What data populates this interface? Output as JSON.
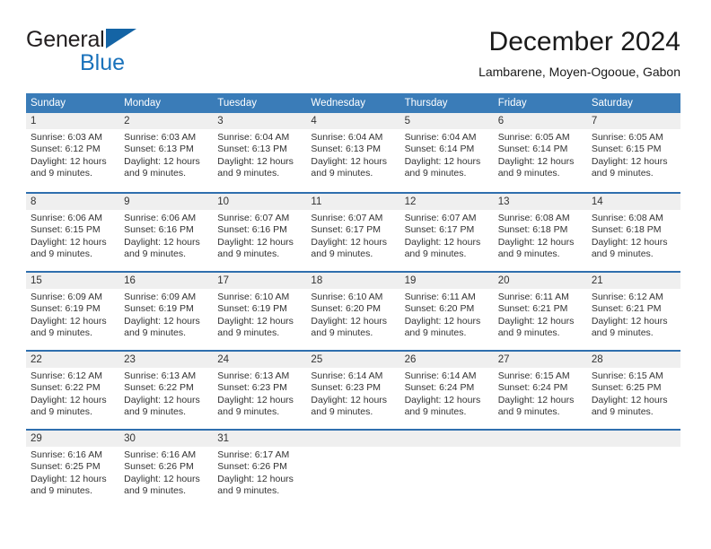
{
  "brand": {
    "word1": "General",
    "word2": "Blue",
    "triangle_color": "#1464a5",
    "word2_color": "#1a72bb"
  },
  "header": {
    "title": "December 2024",
    "subtitle": "Lambarene, Moyen-Ogooue, Gabon"
  },
  "theme": {
    "header_bg": "#3a7cb8",
    "week_divider": "#2f6fae",
    "daynum_bg": "#efefef",
    "text": "#333333"
  },
  "weekdays": [
    "Sunday",
    "Monday",
    "Tuesday",
    "Wednesday",
    "Thursday",
    "Friday",
    "Saturday"
  ],
  "weeks": [
    [
      {
        "day": "1",
        "sunrise": "Sunrise: 6:03 AM",
        "sunset": "Sunset: 6:12 PM",
        "daylight1": "Daylight: 12 hours",
        "daylight2": "and 9 minutes."
      },
      {
        "day": "2",
        "sunrise": "Sunrise: 6:03 AM",
        "sunset": "Sunset: 6:13 PM",
        "daylight1": "Daylight: 12 hours",
        "daylight2": "and 9 minutes."
      },
      {
        "day": "3",
        "sunrise": "Sunrise: 6:04 AM",
        "sunset": "Sunset: 6:13 PM",
        "daylight1": "Daylight: 12 hours",
        "daylight2": "and 9 minutes."
      },
      {
        "day": "4",
        "sunrise": "Sunrise: 6:04 AM",
        "sunset": "Sunset: 6:13 PM",
        "daylight1": "Daylight: 12 hours",
        "daylight2": "and 9 minutes."
      },
      {
        "day": "5",
        "sunrise": "Sunrise: 6:04 AM",
        "sunset": "Sunset: 6:14 PM",
        "daylight1": "Daylight: 12 hours",
        "daylight2": "and 9 minutes."
      },
      {
        "day": "6",
        "sunrise": "Sunrise: 6:05 AM",
        "sunset": "Sunset: 6:14 PM",
        "daylight1": "Daylight: 12 hours",
        "daylight2": "and 9 minutes."
      },
      {
        "day": "7",
        "sunrise": "Sunrise: 6:05 AM",
        "sunset": "Sunset: 6:15 PM",
        "daylight1": "Daylight: 12 hours",
        "daylight2": "and 9 minutes."
      }
    ],
    [
      {
        "day": "8",
        "sunrise": "Sunrise: 6:06 AM",
        "sunset": "Sunset: 6:15 PM",
        "daylight1": "Daylight: 12 hours",
        "daylight2": "and 9 minutes."
      },
      {
        "day": "9",
        "sunrise": "Sunrise: 6:06 AM",
        "sunset": "Sunset: 6:16 PM",
        "daylight1": "Daylight: 12 hours",
        "daylight2": "and 9 minutes."
      },
      {
        "day": "10",
        "sunrise": "Sunrise: 6:07 AM",
        "sunset": "Sunset: 6:16 PM",
        "daylight1": "Daylight: 12 hours",
        "daylight2": "and 9 minutes."
      },
      {
        "day": "11",
        "sunrise": "Sunrise: 6:07 AM",
        "sunset": "Sunset: 6:17 PM",
        "daylight1": "Daylight: 12 hours",
        "daylight2": "and 9 minutes."
      },
      {
        "day": "12",
        "sunrise": "Sunrise: 6:07 AM",
        "sunset": "Sunset: 6:17 PM",
        "daylight1": "Daylight: 12 hours",
        "daylight2": "and 9 minutes."
      },
      {
        "day": "13",
        "sunrise": "Sunrise: 6:08 AM",
        "sunset": "Sunset: 6:18 PM",
        "daylight1": "Daylight: 12 hours",
        "daylight2": "and 9 minutes."
      },
      {
        "day": "14",
        "sunrise": "Sunrise: 6:08 AM",
        "sunset": "Sunset: 6:18 PM",
        "daylight1": "Daylight: 12 hours",
        "daylight2": "and 9 minutes."
      }
    ],
    [
      {
        "day": "15",
        "sunrise": "Sunrise: 6:09 AM",
        "sunset": "Sunset: 6:19 PM",
        "daylight1": "Daylight: 12 hours",
        "daylight2": "and 9 minutes."
      },
      {
        "day": "16",
        "sunrise": "Sunrise: 6:09 AM",
        "sunset": "Sunset: 6:19 PM",
        "daylight1": "Daylight: 12 hours",
        "daylight2": "and 9 minutes."
      },
      {
        "day": "17",
        "sunrise": "Sunrise: 6:10 AM",
        "sunset": "Sunset: 6:19 PM",
        "daylight1": "Daylight: 12 hours",
        "daylight2": "and 9 minutes."
      },
      {
        "day": "18",
        "sunrise": "Sunrise: 6:10 AM",
        "sunset": "Sunset: 6:20 PM",
        "daylight1": "Daylight: 12 hours",
        "daylight2": "and 9 minutes."
      },
      {
        "day": "19",
        "sunrise": "Sunrise: 6:11 AM",
        "sunset": "Sunset: 6:20 PM",
        "daylight1": "Daylight: 12 hours",
        "daylight2": "and 9 minutes."
      },
      {
        "day": "20",
        "sunrise": "Sunrise: 6:11 AM",
        "sunset": "Sunset: 6:21 PM",
        "daylight1": "Daylight: 12 hours",
        "daylight2": "and 9 minutes."
      },
      {
        "day": "21",
        "sunrise": "Sunrise: 6:12 AM",
        "sunset": "Sunset: 6:21 PM",
        "daylight1": "Daylight: 12 hours",
        "daylight2": "and 9 minutes."
      }
    ],
    [
      {
        "day": "22",
        "sunrise": "Sunrise: 6:12 AM",
        "sunset": "Sunset: 6:22 PM",
        "daylight1": "Daylight: 12 hours",
        "daylight2": "and 9 minutes."
      },
      {
        "day": "23",
        "sunrise": "Sunrise: 6:13 AM",
        "sunset": "Sunset: 6:22 PM",
        "daylight1": "Daylight: 12 hours",
        "daylight2": "and 9 minutes."
      },
      {
        "day": "24",
        "sunrise": "Sunrise: 6:13 AM",
        "sunset": "Sunset: 6:23 PM",
        "daylight1": "Daylight: 12 hours",
        "daylight2": "and 9 minutes."
      },
      {
        "day": "25",
        "sunrise": "Sunrise: 6:14 AM",
        "sunset": "Sunset: 6:23 PM",
        "daylight1": "Daylight: 12 hours",
        "daylight2": "and 9 minutes."
      },
      {
        "day": "26",
        "sunrise": "Sunrise: 6:14 AM",
        "sunset": "Sunset: 6:24 PM",
        "daylight1": "Daylight: 12 hours",
        "daylight2": "and 9 minutes."
      },
      {
        "day": "27",
        "sunrise": "Sunrise: 6:15 AM",
        "sunset": "Sunset: 6:24 PM",
        "daylight1": "Daylight: 12 hours",
        "daylight2": "and 9 minutes."
      },
      {
        "day": "28",
        "sunrise": "Sunrise: 6:15 AM",
        "sunset": "Sunset: 6:25 PM",
        "daylight1": "Daylight: 12 hours",
        "daylight2": "and 9 minutes."
      }
    ],
    [
      {
        "day": "29",
        "sunrise": "Sunrise: 6:16 AM",
        "sunset": "Sunset: 6:25 PM",
        "daylight1": "Daylight: 12 hours",
        "daylight2": "and 9 minutes."
      },
      {
        "day": "30",
        "sunrise": "Sunrise: 6:16 AM",
        "sunset": "Sunset: 6:26 PM",
        "daylight1": "Daylight: 12 hours",
        "daylight2": "and 9 minutes."
      },
      {
        "day": "31",
        "sunrise": "Sunrise: 6:17 AM",
        "sunset": "Sunset: 6:26 PM",
        "daylight1": "Daylight: 12 hours",
        "daylight2": "and 9 minutes."
      },
      {
        "day": "",
        "sunrise": "",
        "sunset": "",
        "daylight1": "",
        "daylight2": ""
      },
      {
        "day": "",
        "sunrise": "",
        "sunset": "",
        "daylight1": "",
        "daylight2": ""
      },
      {
        "day": "",
        "sunrise": "",
        "sunset": "",
        "daylight1": "",
        "daylight2": ""
      },
      {
        "day": "",
        "sunrise": "",
        "sunset": "",
        "daylight1": "",
        "daylight2": ""
      }
    ]
  ]
}
